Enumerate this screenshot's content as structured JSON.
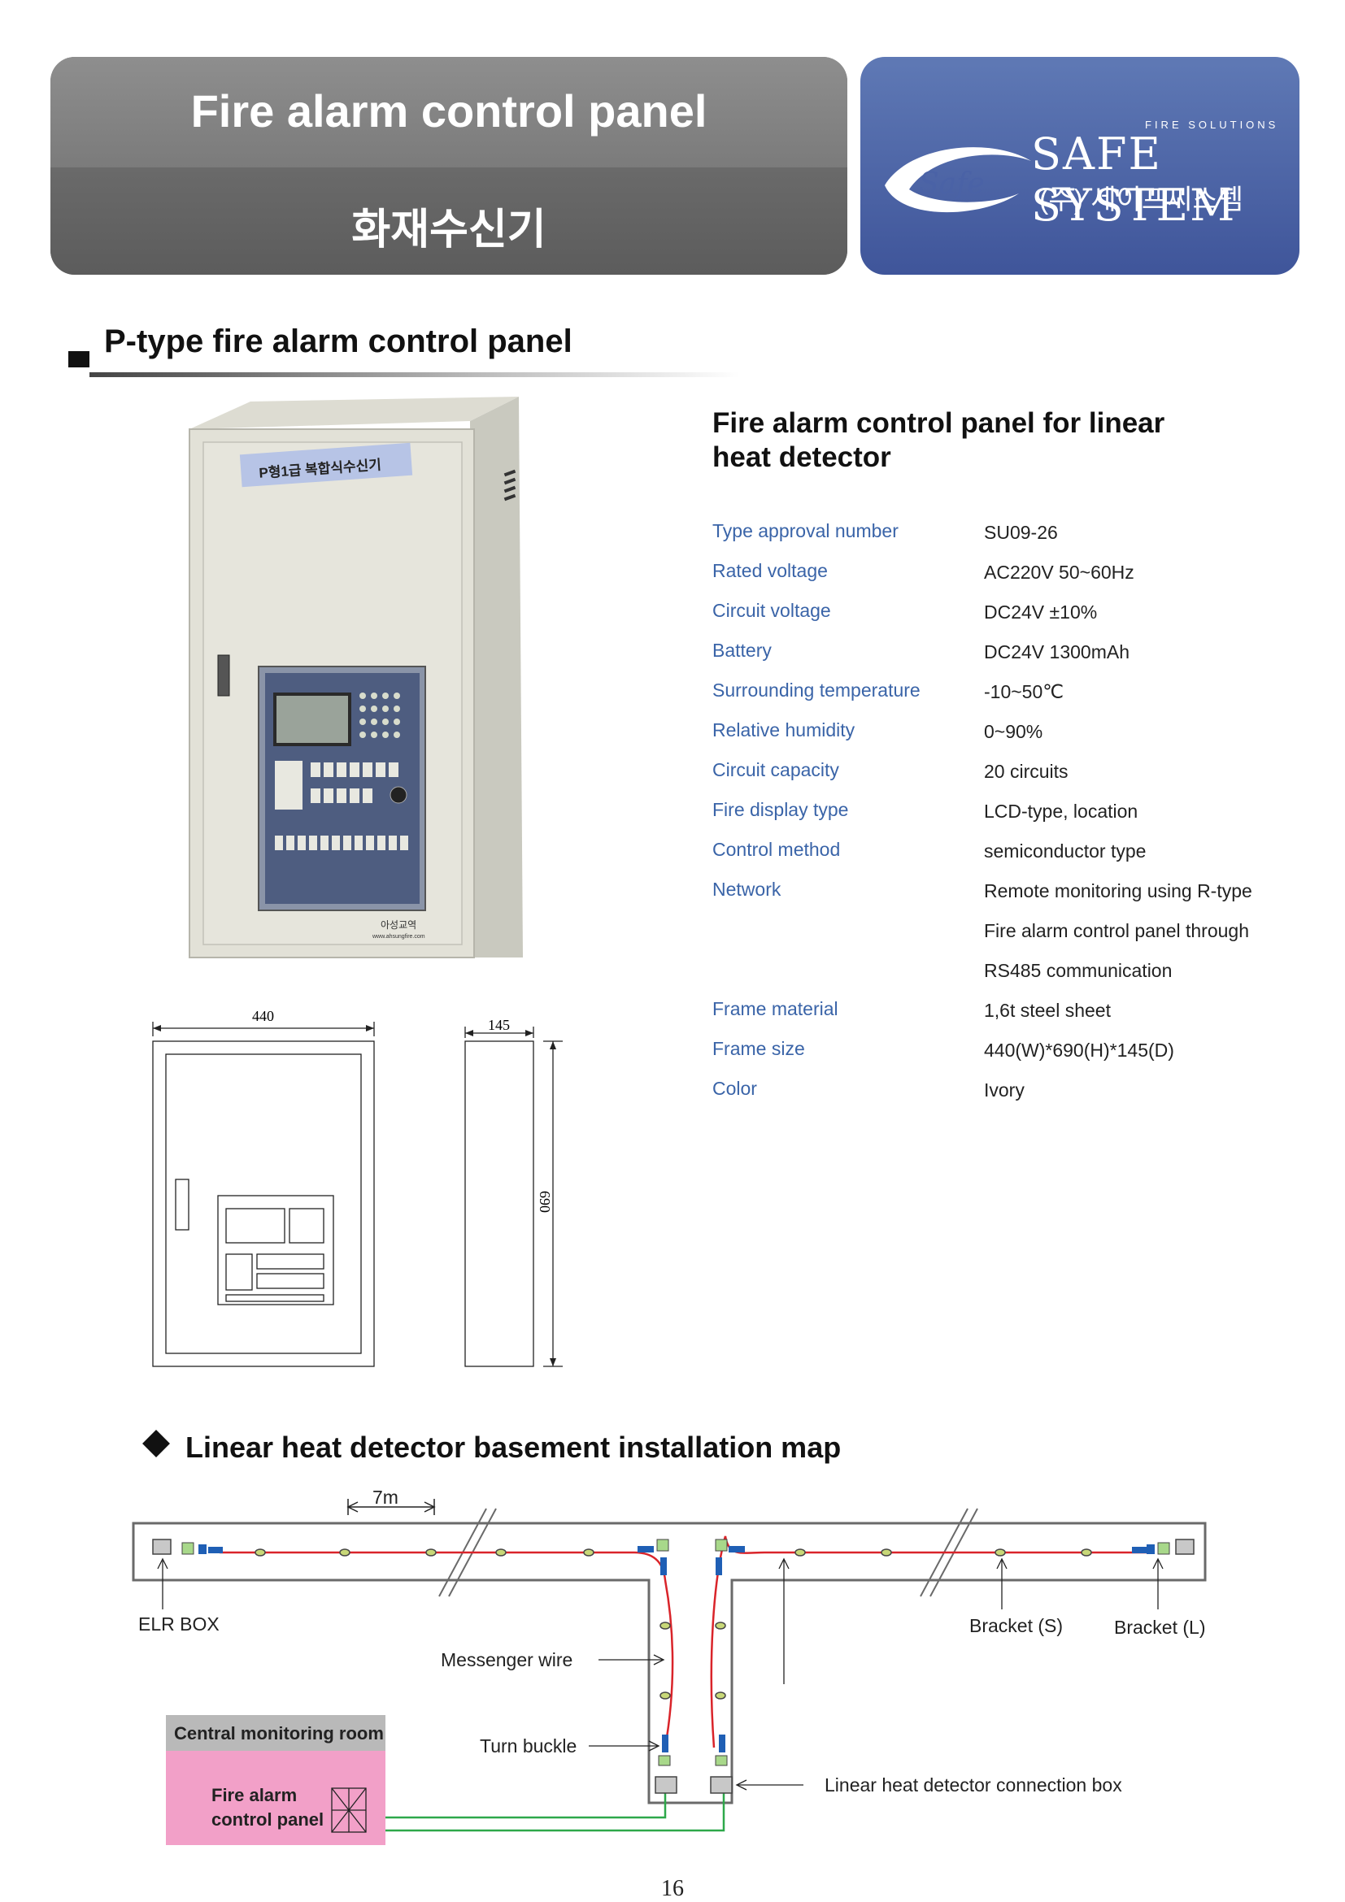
{
  "header": {
    "title": "Fire alarm control panel",
    "subtitle": "화재수신기",
    "logo": {
      "badge": "Safe",
      "tagline": "FIRE SOLUTIONS",
      "name": "SAFE SYSTEM",
      "korean": "(주) 세이프씨스템"
    }
  },
  "section": {
    "title": "P-type fire alarm control panel"
  },
  "product": {
    "panel_label": "P형1급 복합식수신기",
    "panel_brand": "아성교역",
    "panel_url": "www.ahsungfire.com"
  },
  "spec": {
    "title_line1": "Fire alarm control panel for linear",
    "title_line2": "heat detector",
    "rows": [
      {
        "label": "Type approval number",
        "value": "SU09-26"
      },
      {
        "label": "Rated voltage",
        "value": "AC220V 50~60Hz"
      },
      {
        "label": "Circuit voltage",
        "value": "DC24V ±10%"
      },
      {
        "label": "Battery",
        "value": "DC24V 1300mAh"
      },
      {
        "label": "Surrounding temperature",
        "value": "-10~50℃"
      },
      {
        "label": "Relative humidity",
        "value": "0~90%"
      },
      {
        "label": "Circuit capacity",
        "value": "20 circuits"
      },
      {
        "label": "Fire display type",
        "value": "LCD-type, location"
      },
      {
        "label": "Control method",
        "value": "semiconductor type"
      },
      {
        "label": "Network",
        "value": "Remote monitoring using R-type",
        "value2": "Fire alarm control panel through",
        "value3": "RS485 communication"
      },
      {
        "label": "Frame material",
        "value": "1,6t steel sheet"
      },
      {
        "label": "Frame size",
        "value": "440(W)*690(H)*145(D)"
      },
      {
        "label": "Color",
        "value": "Ivory"
      }
    ]
  },
  "drawing": {
    "width": "440",
    "depth": "145",
    "height": "690"
  },
  "map": {
    "title": "Linear heat detector basement installation map",
    "spacing": "7m",
    "labels": {
      "elr_box": "ELR BOX",
      "bracket_s": "Bracket (S)",
      "bracket_l": "Bracket (L)",
      "messenger_wire": "Messenger wire",
      "turn_buckle": "Turn buckle",
      "connection_box": "Linear heat detector connection box",
      "central_room": "Central monitoring room",
      "panel_line1": "Fire alarm",
      "panel_line2": "control panel"
    }
  },
  "page_number": "16",
  "colors": {
    "header_blue": "#4a62a6",
    "label_blue": "#3a64a8",
    "cable_red": "#d9242a",
    "cable_green": "#2ea84a",
    "room_pink": "#f2a0c8"
  }
}
